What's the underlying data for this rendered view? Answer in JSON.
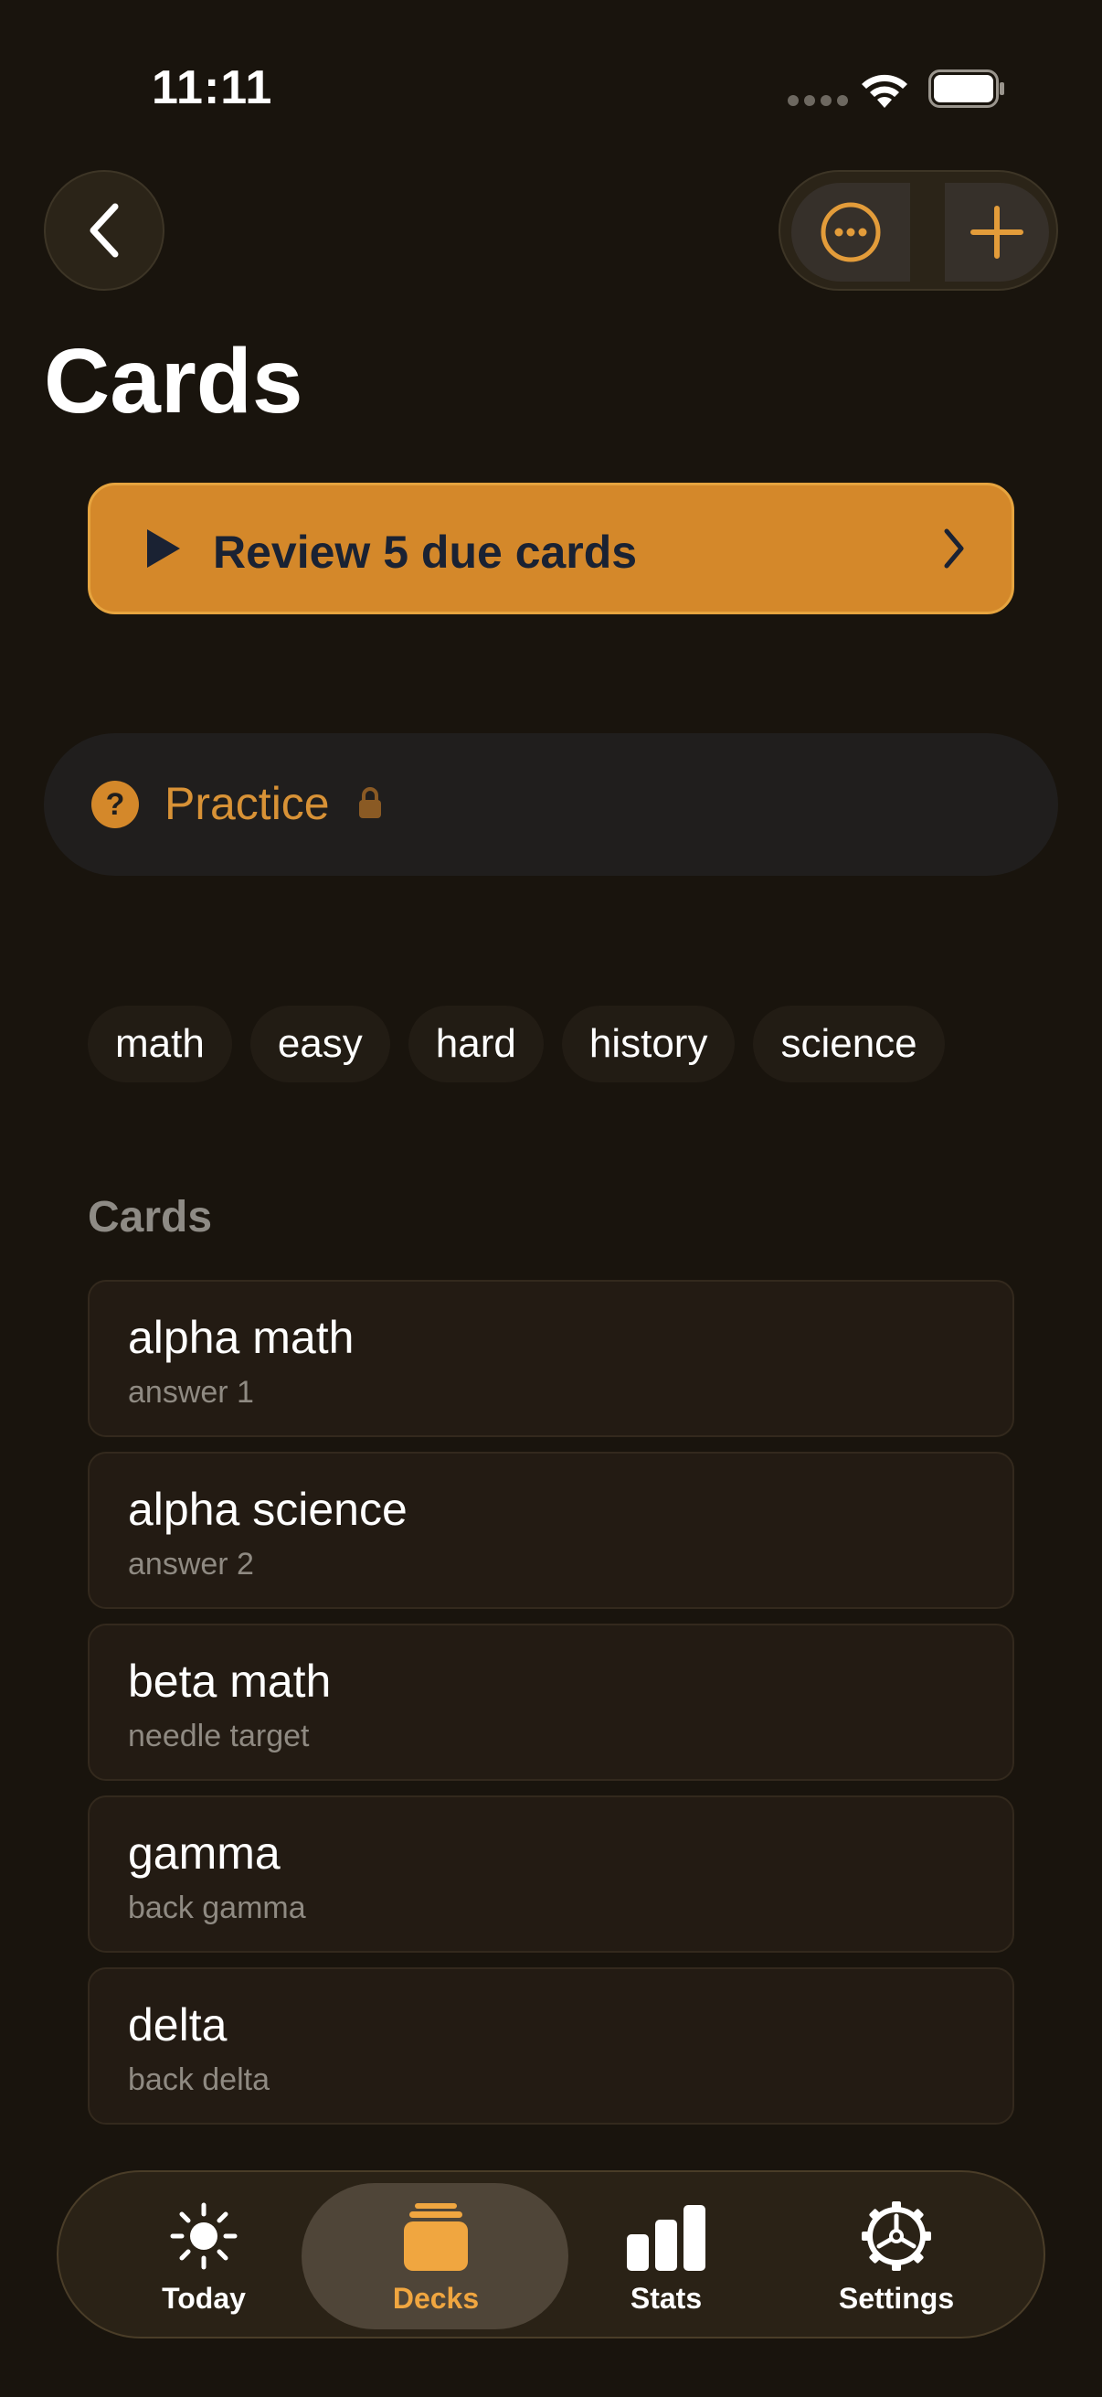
{
  "status_bar": {
    "time": "11:11"
  },
  "header": {
    "title": "Cards"
  },
  "review": {
    "label": "Review 5 due cards"
  },
  "practice": {
    "label": "Practice"
  },
  "tags": [
    "math",
    "easy",
    "hard",
    "history",
    "science"
  ],
  "cards_section": {
    "title": "Cards",
    "items": [
      {
        "front": "alpha math",
        "back": "answer 1"
      },
      {
        "front": "alpha science",
        "back": "answer 2"
      },
      {
        "front": "beta math",
        "back": "needle target"
      },
      {
        "front": "gamma",
        "back": "back gamma"
      },
      {
        "front": "delta",
        "back": "back delta"
      }
    ]
  },
  "tab_bar": {
    "active": "Decks",
    "tabs": [
      {
        "label": "Today",
        "icon": "sun-icon"
      },
      {
        "label": "Decks",
        "icon": "decks-icon"
      },
      {
        "label": "Stats",
        "icon": "bar-chart-icon"
      },
      {
        "label": "Settings",
        "icon": "gear-icon"
      }
    ]
  },
  "colors": {
    "accent": "#d4882a",
    "background": "#19140d",
    "active_tab": "#f0a640"
  }
}
